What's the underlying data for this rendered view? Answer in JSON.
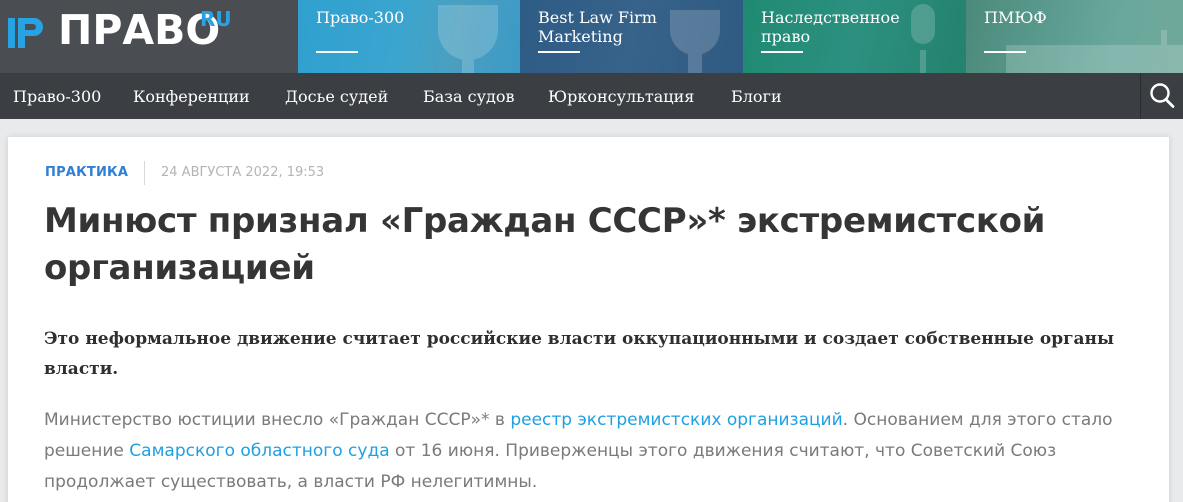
{
  "logo": {
    "text": "ПРАВО",
    "suffix": "RU"
  },
  "promos": [
    {
      "label": "Право-300"
    },
    {
      "label": "Best Law Firm Marketing"
    },
    {
      "label": "Наследственное право"
    },
    {
      "label": "ПМЮФ"
    }
  ],
  "nav": {
    "items": [
      {
        "label": "Право-300"
      },
      {
        "label": "Конференции"
      },
      {
        "label": "Досье судей"
      },
      {
        "label": "База судов"
      },
      {
        "label": "Юрконсультация"
      },
      {
        "label": "Блоги"
      }
    ],
    "search_icon": "search-icon"
  },
  "article": {
    "category": "ПРАКТИКА",
    "date": "24 АВГУСТА 2022, 19:53",
    "title": "Минюст признал «Граждан СССР»* экстремистской организацией",
    "lead": "Это неформальное движение считает российские власти оккупационными и создает собственные органы власти.",
    "body": {
      "part1": "Министерство юстиции внесло «Граждан СССР»* в ",
      "link1": "реестр экстремистских организаций",
      "part2": ". Основанием для этого стало решение ",
      "link2": "Самарского областного суда",
      "part3": " от 16 июня. Приверженцы этого движения считают, что Советский Союз продолжает существовать, а власти РФ нелегитимны."
    }
  },
  "colors": {
    "header_bg": "#4a4d52",
    "nav_bg": "#3b3e43",
    "accent_blue": "#27a3e3",
    "link": "#1ea0e3",
    "category": "#2f7fd6"
  }
}
